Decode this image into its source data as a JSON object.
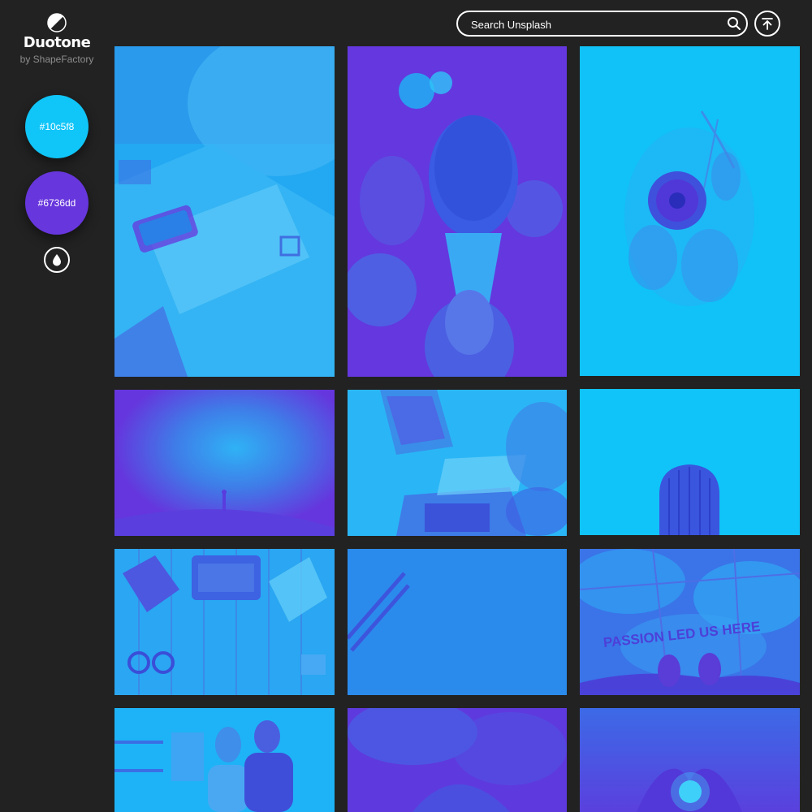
{
  "brand": {
    "title": "Duotone",
    "subtitle": "by ShapeFactory",
    "logo_icon": "half-circle-icon"
  },
  "palette": {
    "color_1": "#10c5f8",
    "color_2": "#6736dd",
    "swatches": [
      {
        "label": "#10c5f8",
        "color": "#10c5f8"
      },
      {
        "label": "#6736dd",
        "color": "#6736dd"
      }
    ],
    "toggle_icon": "droplet-icon"
  },
  "header": {
    "search_placeholder": "Search Unsplash",
    "search_icon": "search-icon",
    "top_button_icon": "arrow-up-to-top-icon"
  },
  "photos": [
    {
      "subject": "tablet-payment-desk",
      "tone": "light"
    },
    {
      "subject": "ice-cream-cone",
      "tone": "dark"
    },
    {
      "subject": "flower-bouquet",
      "tone": "light"
    },
    {
      "subject": "milky-way-silhouette",
      "tone": "dark"
    },
    {
      "subject": "laptops-notes-desk",
      "tone": "light"
    },
    {
      "subject": "cactus",
      "tone": "light"
    },
    {
      "subject": "typewriter-desk",
      "tone": "light"
    },
    {
      "subject": "pencils",
      "tone": "mid"
    },
    {
      "subject": "feet-passion-text",
      "tone": "mid",
      "text": "PASSION LED US HERE"
    },
    {
      "subject": "couple-kitchen",
      "tone": "light"
    },
    {
      "subject": "space-nebula",
      "tone": "dark"
    },
    {
      "subject": "heart-hands",
      "tone": "dark"
    }
  ]
}
